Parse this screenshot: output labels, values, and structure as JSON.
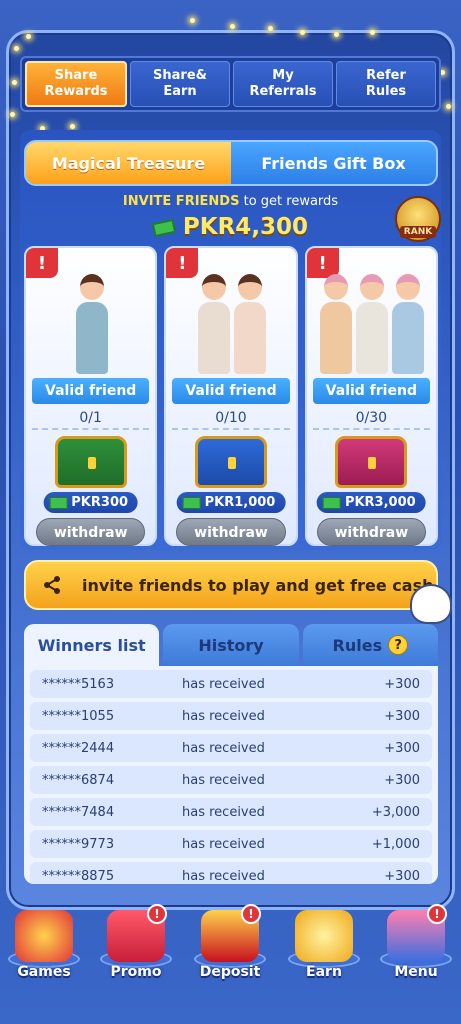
{
  "top_tabs": [
    {
      "label": "Share\nRewards",
      "active": true
    },
    {
      "label": "Share&\nEarn",
      "active": false
    },
    {
      "label": "My\nReferrals",
      "active": false
    },
    {
      "label": "Refer\nRules",
      "active": false
    }
  ],
  "segment": {
    "left": "Magical Treasure",
    "right": "Friends Gift Box"
  },
  "invite_header": {
    "highlight": "INVITE FRIENDS",
    "rest": "to get  rewards"
  },
  "total_amount": "PKR4,300",
  "rank_label": "RANK",
  "alert_mark": "!",
  "cards": [
    {
      "valid_label": "Valid friend",
      "progress": "0/1",
      "reward": "PKR300",
      "withdraw": "withdraw"
    },
    {
      "valid_label": "Valid friend",
      "progress": "0/10",
      "reward": "PKR1,000",
      "withdraw": "withdraw"
    },
    {
      "valid_label": "Valid friend",
      "progress": "0/30",
      "reward": "PKR3,000",
      "withdraw": "withdraw"
    }
  ],
  "invite_button": "invite friends to play and get free cash",
  "list_tabs": {
    "winners": "Winners list",
    "history": "History",
    "rules": "Rules",
    "rules_icon": "?"
  },
  "winners": [
    {
      "user": "******5163",
      "status": "has received",
      "amount": "+300"
    },
    {
      "user": "******1055",
      "status": "has received",
      "amount": "+300"
    },
    {
      "user": "******2444",
      "status": "has received",
      "amount": "+300"
    },
    {
      "user": "******6874",
      "status": "has received",
      "amount": "+300"
    },
    {
      "user": "******7484",
      "status": "has received",
      "amount": "+3,000"
    },
    {
      "user": "******9773",
      "status": "has received",
      "amount": "+1,000"
    },
    {
      "user": "******8875",
      "status": "has received",
      "amount": "+300"
    }
  ],
  "nav": [
    {
      "label": "Games",
      "badge": ""
    },
    {
      "label": "Promo",
      "badge": "!"
    },
    {
      "label": "Deposit",
      "badge": "!"
    },
    {
      "label": "Earn",
      "badge": ""
    },
    {
      "label": "Menu",
      "badge": "!"
    }
  ]
}
